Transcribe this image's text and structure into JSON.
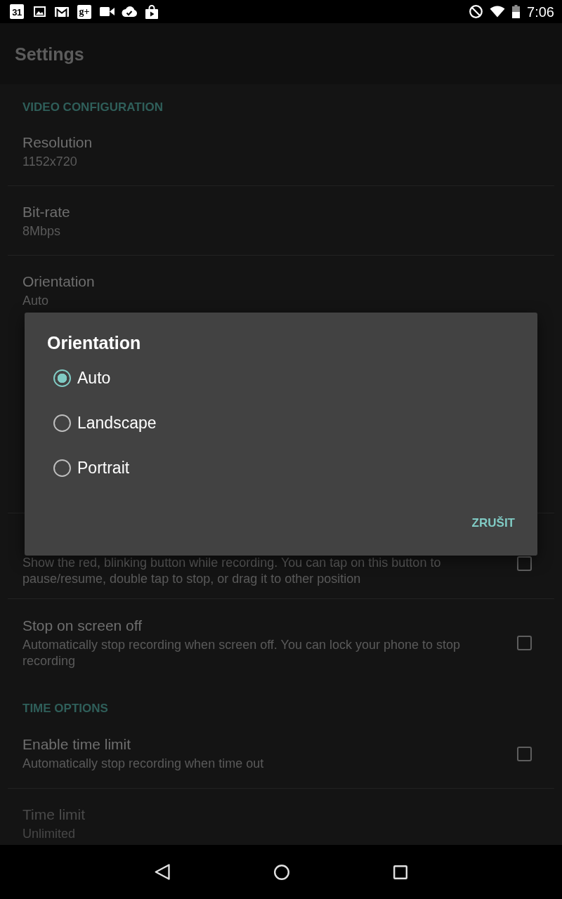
{
  "status_bar": {
    "calendar_day": "31",
    "gplus_label": "g+",
    "time": "7:06"
  },
  "app_bar": {
    "title": "Settings"
  },
  "sections": [
    {
      "header": "VIDEO CONFIGURATION",
      "items": [
        {
          "kind": "value",
          "title": "Resolution",
          "summary": "1152x720",
          "disabled": false
        },
        {
          "kind": "value",
          "title": "Bit-rate",
          "summary": "8Mbps",
          "disabled": false
        },
        {
          "kind": "value",
          "title": "Orientation",
          "summary": "Auto",
          "disabled": false
        }
      ]
    },
    {
      "items": [
        {
          "kind": "checkbox",
          "summary": "Show the red, blinking button while recording. You can tap on this button to pause/resume, double tap to stop, or drag it to other position",
          "checked": false,
          "disabled": false
        },
        {
          "kind": "checkbox",
          "title": "Stop on screen off",
          "summary": "Automatically stop recording when screen off. You can lock your phone to stop recording",
          "checked": false,
          "disabled": false
        }
      ]
    },
    {
      "header": "TIME OPTIONS",
      "items": [
        {
          "kind": "checkbox",
          "title": "Enable time limit",
          "summary": "Automatically stop recording when time out",
          "checked": false,
          "disabled": false
        },
        {
          "kind": "value",
          "title": "Time limit",
          "summary": "Unlimited",
          "disabled": true
        }
      ]
    }
  ],
  "dialog": {
    "title": "Orientation",
    "options": [
      {
        "label": "Auto",
        "selected": true
      },
      {
        "label": "Landscape",
        "selected": false
      },
      {
        "label": "Portrait",
        "selected": false
      }
    ],
    "buttons": [
      "ZRUŠIT"
    ]
  }
}
